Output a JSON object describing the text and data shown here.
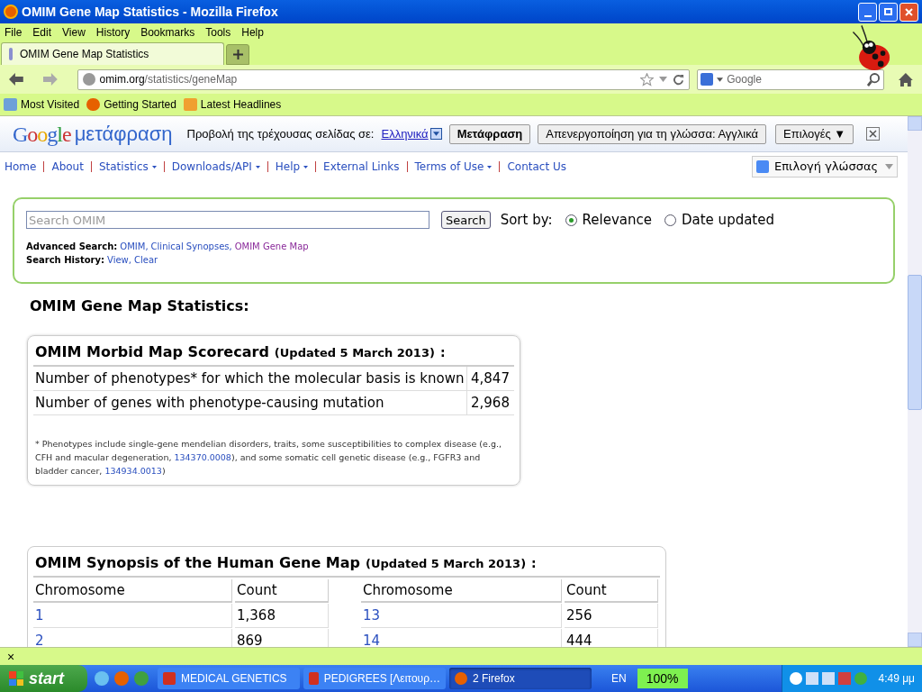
{
  "window": {
    "title": "OMIM Gene Map Statistics - Mozilla Firefox"
  },
  "menu": [
    "File",
    "Edit",
    "View",
    "History",
    "Bookmarks",
    "Tools",
    "Help"
  ],
  "tab": {
    "title": "OMIM Gene Map Statistics"
  },
  "address": {
    "domain": "omim.org",
    "path": "/statistics/geneMap"
  },
  "web_search": {
    "placeholder": "Google"
  },
  "bookmarks": [
    "Most Visited",
    "Getting Started",
    "Latest Headlines"
  ],
  "translate_bar": {
    "logo": "Google",
    "logo_suffix": "μετάφραση",
    "prompt": "Προβολή της τρέχουσας σελίδας σε:",
    "language": "Ελληνικά",
    "translate_button": "Μετάφραση",
    "disable_button": "Απενεργοποίηση για τη γλώσσα: Αγγλικά",
    "options_button": "Επιλογές ▼"
  },
  "site_nav": [
    {
      "label": "Home",
      "dropdown": false
    },
    {
      "label": "About",
      "dropdown": false
    },
    {
      "label": "Statistics",
      "dropdown": true
    },
    {
      "label": "Downloads/API",
      "dropdown": true
    },
    {
      "label": "Help",
      "dropdown": true
    },
    {
      "label": "External Links",
      "dropdown": false
    },
    {
      "label": "Terms of Use",
      "dropdown": true
    },
    {
      "label": "Contact Us",
      "dropdown": false
    }
  ],
  "language_select": "Επιλογή γλώσσας",
  "search": {
    "placeholder": "Search OMIM",
    "button": "Search",
    "sort_label": "Sort by:",
    "sort_options": [
      {
        "label": "Relevance",
        "selected": true
      },
      {
        "label": "Date updated",
        "selected": false
      }
    ],
    "advanced_label": "Advanced Search:",
    "advanced_links": [
      {
        "label": "OMIM,",
        "visited": false
      },
      {
        "label": "Clinical Synopses,",
        "visited": false
      },
      {
        "label": "OMIM Gene Map",
        "visited": true
      }
    ],
    "history_label": "Search History:",
    "history_links": [
      {
        "label": "View,",
        "visited": false
      },
      {
        "label": "Clear",
        "visited": false
      }
    ]
  },
  "page_heading": "OMIM Gene Map Statistics:",
  "scorecard": {
    "title": "OMIM Morbid Map Scorecard",
    "updated": "(Updated 5 March 2013)",
    "colon": ":",
    "rows": [
      {
        "label": "Number of phenotypes* for which the molecular basis is known",
        "value": "4,847"
      },
      {
        "label": "Number of genes with phenotype-causing mutation",
        "value": "2,968"
      }
    ],
    "footnote": [
      {
        "kind": "text",
        "text": "* Phenotypes include single-gene mendelian disorders, traits, some susceptibilities to complex disease (e.g., CFH and macular degeneration, "
      },
      {
        "kind": "link",
        "text": "134370.0008"
      },
      {
        "kind": "text",
        "text": "), and some somatic cell genetic disease (e.g., FGFR3 and bladder cancer, "
      },
      {
        "kind": "link",
        "text": "134934.0013"
      },
      {
        "kind": "text",
        "text": ")"
      }
    ]
  },
  "synopsis": {
    "title": "OMIM Synopsis of the Human Gene Map",
    "updated": "(Updated 5 March 2013)",
    "colon": ":",
    "left_columns": [
      "Chromosome",
      "Count"
    ],
    "right_columns": [
      "Chromosome",
      "Count"
    ],
    "left_rows": [
      {
        "chromosome": "1",
        "count": "1,368"
      },
      {
        "chromosome": "2",
        "count": "869"
      }
    ],
    "right_rows": [
      {
        "chromosome": "13",
        "count": "256"
      },
      {
        "chromosome": "14",
        "count": "444"
      }
    ]
  },
  "find_bar": {
    "close": "×"
  },
  "taskbar": {
    "start": "start",
    "tasks": [
      {
        "label": "MEDICAL GENETICS",
        "selected": false
      },
      {
        "label": "PEDIGREES [Λειτουρ…",
        "selected": false
      },
      {
        "label": "2 Firefox",
        "selected": true
      }
    ],
    "language": "EN",
    "zoom": "100%",
    "clock": "4:49 μμ"
  }
}
